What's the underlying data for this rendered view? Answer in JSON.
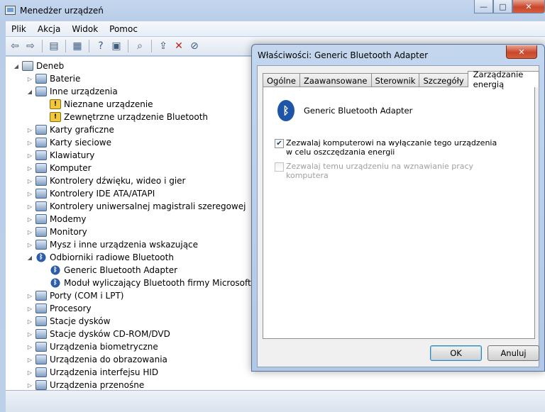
{
  "main_window": {
    "title": "Menedżer urządzeń",
    "buttons": {
      "minimize": "—",
      "maximize": "□",
      "close": "✕"
    }
  },
  "menu": [
    "Plik",
    "Akcja",
    "Widok",
    "Pomoc"
  ],
  "toolbar": {
    "icons": [
      "back-arrow-icon",
      "forward-arrow-icon",
      "show-hide-tree-icon",
      "properties-icon",
      "help-icon",
      "action-pane-icon",
      "scan-hardware-icon",
      "update-driver-icon",
      "uninstall-icon",
      "disable-icon"
    ]
  },
  "tree": {
    "root": "Deneb",
    "nodes": [
      {
        "label": "Baterie",
        "level": 1,
        "expanded": false
      },
      {
        "label": "Inne urządzenia",
        "level": 1,
        "expanded": true
      },
      {
        "label": "Nieznane urządzenie",
        "level": 2,
        "icon": "warning"
      },
      {
        "label": "Zewnętrzne urządzenie Bluetooth",
        "level": 2,
        "icon": "warning"
      },
      {
        "label": "Karty graficzne",
        "level": 1,
        "expanded": false
      },
      {
        "label": "Karty sieciowe",
        "level": 1,
        "expanded": false
      },
      {
        "label": "Klawiatury",
        "level": 1,
        "expanded": false
      },
      {
        "label": "Komputer",
        "level": 1,
        "expanded": false
      },
      {
        "label": "Kontrolery dźwięku, wideo i gier",
        "level": 1,
        "expanded": false
      },
      {
        "label": "Kontrolery IDE ATA/ATAPI",
        "level": 1,
        "expanded": false
      },
      {
        "label": "Kontrolery uniwersalnej magistrali szeregowej",
        "level": 1,
        "expanded": false
      },
      {
        "label": "Modemy",
        "level": 1,
        "expanded": false
      },
      {
        "label": "Monitory",
        "level": 1,
        "expanded": false
      },
      {
        "label": "Mysz i inne urządzenia wskazujące",
        "level": 1,
        "expanded": false
      },
      {
        "label": "Odbiorniki radiowe Bluetooth",
        "level": 1,
        "expanded": true,
        "icon": "bluetooth"
      },
      {
        "label": "Generic Bluetooth Adapter",
        "level": 2,
        "icon": "bluetooth"
      },
      {
        "label": "Moduł wyliczający Bluetooth firmy Microsoft",
        "level": 2,
        "icon": "bluetooth"
      },
      {
        "label": "Porty (COM i LPT)",
        "level": 1,
        "expanded": false
      },
      {
        "label": "Procesory",
        "level": 1,
        "expanded": false
      },
      {
        "label": "Stacje dysków",
        "level": 1,
        "expanded": false
      },
      {
        "label": "Stacje dysków CD-ROM/DVD",
        "level": 1,
        "expanded": false
      },
      {
        "label": "Urządzenia biometryczne",
        "level": 1,
        "expanded": false
      },
      {
        "label": "Urządzenia do obrazowania",
        "level": 1,
        "expanded": false
      },
      {
        "label": "Urządzenia interfejsu HID",
        "level": 1,
        "expanded": false
      },
      {
        "label": "Urządzenia przenośne",
        "level": 1,
        "expanded": false
      }
    ]
  },
  "dialog": {
    "title": "Właściwości: Generic Bluetooth Adapter",
    "close_glyph": "✕",
    "tabs": [
      "Ogólne",
      "Zaawansowane",
      "Sterownik",
      "Szczegóły",
      "Zarządzanie energią"
    ],
    "active_tab": "Zarządzanie energią",
    "device_name": "Generic Bluetooth Adapter",
    "bluetooth_glyph": "ᛒ",
    "options": [
      {
        "label": "Zezwalaj komputerowi na wyłączanie tego urządzenia w celu oszczędzania energii",
        "checked": true,
        "enabled": true
      },
      {
        "label": "Zezwalaj temu urządzeniu na wznawianie pracy komputera",
        "checked": false,
        "enabled": false
      }
    ],
    "ok_label": "OK",
    "cancel_label": "Anuluj"
  }
}
